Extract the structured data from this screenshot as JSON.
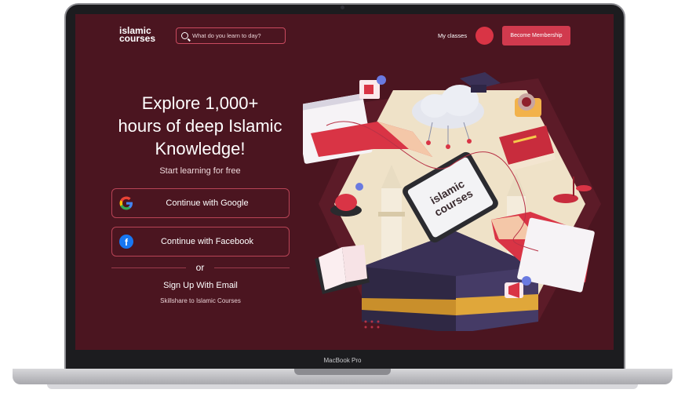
{
  "app": {
    "logo_line1": "islamic",
    "logo_line2": "courses"
  },
  "search": {
    "placeholder": "What do you learn to day?"
  },
  "nav": {
    "my_classes": "My classes",
    "become_membership": "Become Membership"
  },
  "hero": {
    "title_line1": "Explore 1,000+",
    "title_line2": "hours of deep Islamic",
    "title_line3": "Knowledge!",
    "subtitle": "Start  learning for free"
  },
  "auth": {
    "google_label": "Continue with Google",
    "facebook_label": "Continue with Facebook",
    "or": "or",
    "signup_email": "Sign Up With Email",
    "skillshare": "Skillshare to Islamic Courses"
  },
  "illustration": {
    "tablet_line1": "islamic",
    "tablet_line2": "courses"
  },
  "device": {
    "model": "MacBook Pro"
  },
  "colors": {
    "background": "#4b1520",
    "accent": "#d13a4e",
    "avatar": "#d93445"
  }
}
